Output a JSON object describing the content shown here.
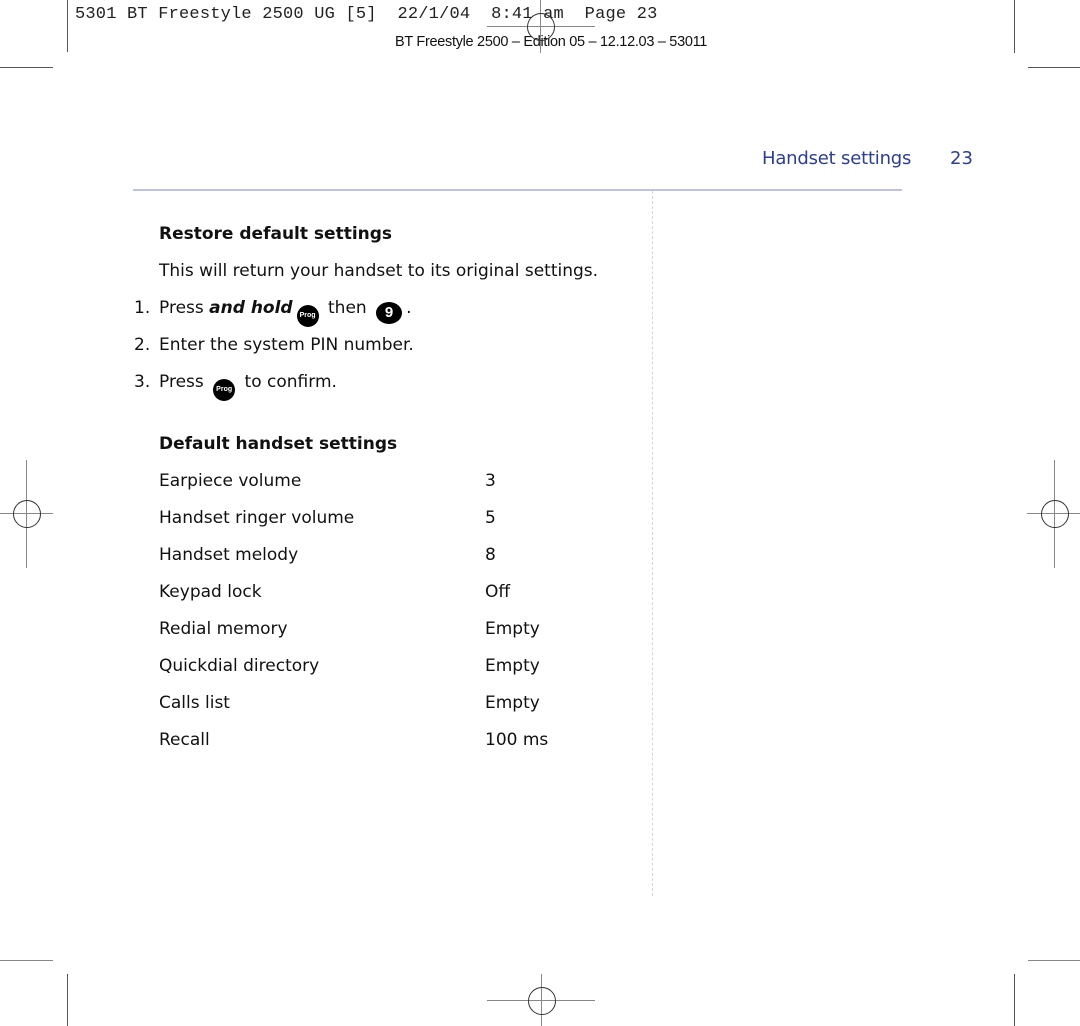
{
  "slug_line": "5301 BT Freestyle 2500 UG [5]  22/1/04  8:41 am  Page 23",
  "edition_line": "BT Freestyle 2500 – Edition 05 – 12.12.03 – 53011",
  "running_head": {
    "section": "Handset settings",
    "page_number": "23"
  },
  "restore": {
    "heading": "Restore default settings",
    "intro": "This will return your handset to its original settings.",
    "steps": [
      {
        "num": "1.",
        "pre": "Press ",
        "emph": "and hold",
        "key1": "Prog",
        "mid": " then ",
        "key2": "9",
        "post": "."
      },
      {
        "num": "2.",
        "text": "Enter the system PIN number."
      },
      {
        "num": "3.",
        "pre": "Press ",
        "key1": "Prog",
        "post": " to confirm."
      }
    ]
  },
  "defaults": {
    "heading": "Default handset settings",
    "rows": [
      {
        "setting": "Earpiece volume",
        "value": "3"
      },
      {
        "setting": "Handset ringer volume",
        "value": "5"
      },
      {
        "setting": "Handset melody",
        "value": "8"
      },
      {
        "setting": "Keypad lock",
        "value": "Off"
      },
      {
        "setting": "Redial memory",
        "value": "Empty"
      },
      {
        "setting": "Quickdial directory",
        "value": "Empty"
      },
      {
        "setting": "Calls list",
        "value": "Empty"
      },
      {
        "setting": "Recall",
        "value": "100 ms"
      }
    ]
  },
  "icons": {
    "prog_key": "prog-button-icon",
    "nine_key": "nine-key-icon",
    "registration_mark": "crosshair-registration-mark"
  },
  "colors": {
    "accent_blue": "#2c3e8c",
    "rule_lavender": "#c0c0e0"
  }
}
